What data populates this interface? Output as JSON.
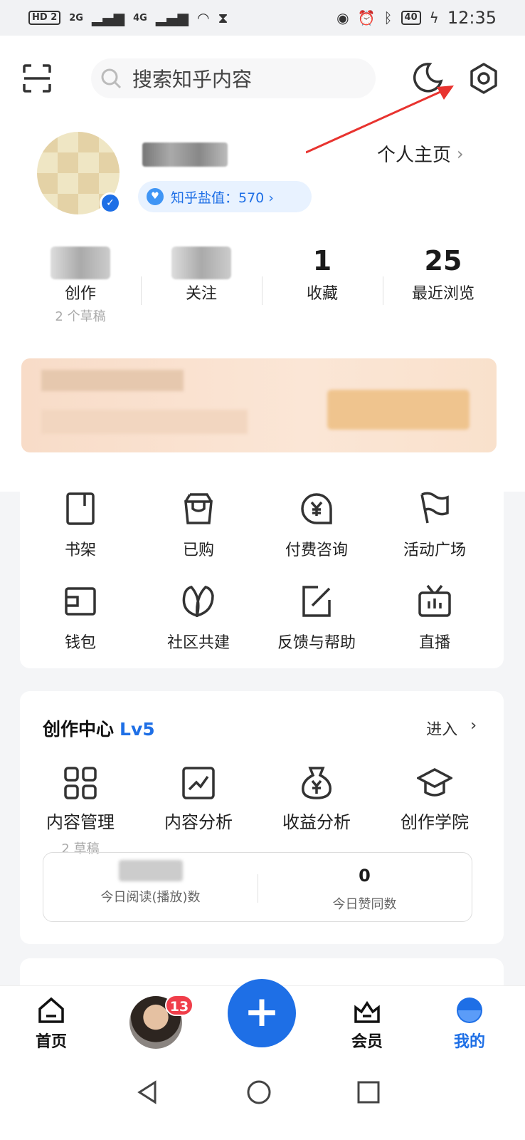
{
  "status_bar": {
    "hd": "HD 2",
    "net1": "2G",
    "net2": "4G",
    "battery": "40",
    "time": "12:35"
  },
  "search": {
    "placeholder": "搜索知乎内容"
  },
  "profile": {
    "homepage_label": "个人主页",
    "salt_label": "知乎盐值：570 ›",
    "verified_icon": "verified-check-icon"
  },
  "stats": [
    {
      "value": "",
      "label": "创作",
      "sub": "2 个草稿"
    },
    {
      "value": "",
      "label": "关注",
      "sub": ""
    },
    {
      "value": "1",
      "label": "收藏",
      "sub": ""
    },
    {
      "value": "25",
      "label": "最近浏览",
      "sub": ""
    }
  ],
  "tools": [
    {
      "label": "书架",
      "icon": "bookshelf-icon"
    },
    {
      "label": "已购",
      "icon": "shopping-bag-icon"
    },
    {
      "label": "付费咨询",
      "icon": "paid-consult-icon"
    },
    {
      "label": "活动广场",
      "icon": "flag-icon"
    },
    {
      "label": "钱包",
      "icon": "wallet-icon"
    },
    {
      "label": "社区共建",
      "icon": "leaf-icon"
    },
    {
      "label": "反馈与帮助",
      "icon": "edit-icon"
    },
    {
      "label": "直播",
      "icon": "tv-icon"
    }
  ],
  "creation_center": {
    "title": "创作中心",
    "level": "Lv5",
    "enter_label": "进入",
    "tools": [
      {
        "label": "内容管理",
        "sub": "2 草稿",
        "icon": "grid-icon"
      },
      {
        "label": "内容分析",
        "sub": "",
        "icon": "chart-icon"
      },
      {
        "label": "收益分析",
        "sub": "",
        "icon": "money-bag-icon"
      },
      {
        "label": "创作学院",
        "sub": "",
        "icon": "graduation-cap-icon"
      }
    ],
    "today": [
      {
        "value": "",
        "label": "今日阅读(播放)数"
      },
      {
        "value": "0",
        "label": "今日赞同数"
      }
    ]
  },
  "bottom_nav": {
    "home": "首页",
    "messages_badge": "13",
    "fab": "+",
    "vip": "会员",
    "me": "我的"
  },
  "colors": {
    "accent": "#1e6fe6",
    "badge": "#f03e4a",
    "arrow": "#e8332f"
  }
}
